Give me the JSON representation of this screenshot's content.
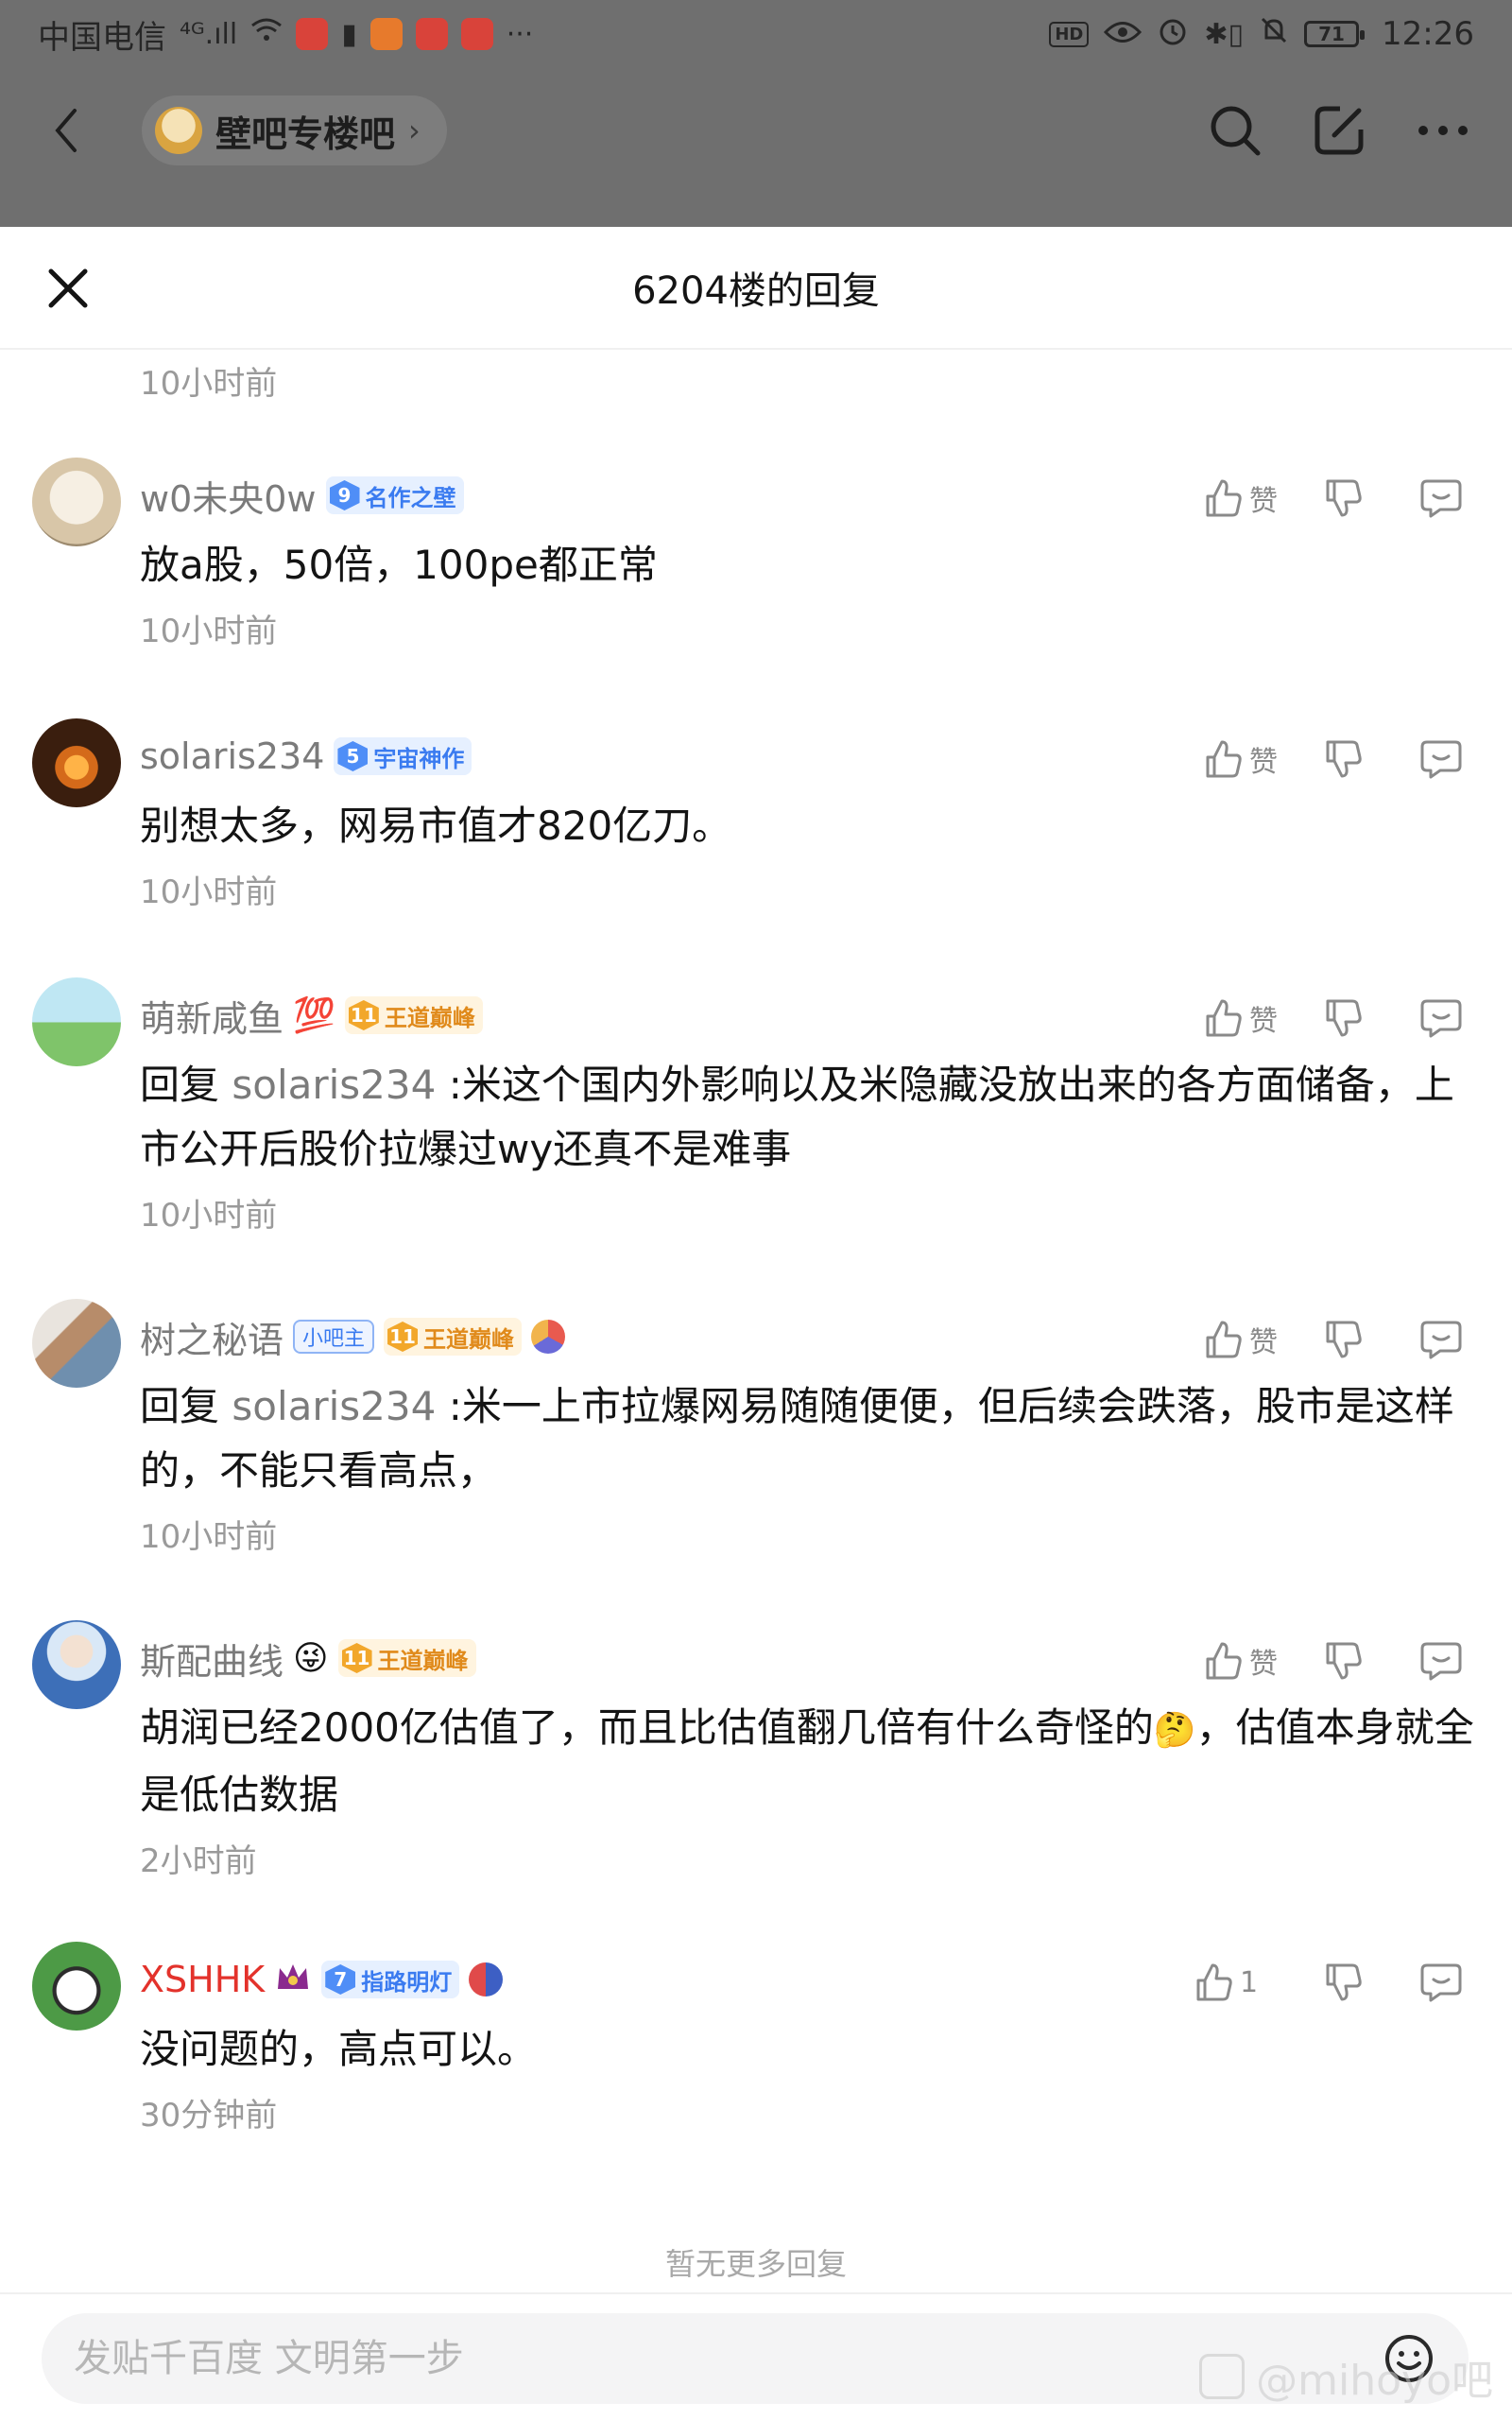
{
  "status_bar": {
    "carrier": "中国电信",
    "signal": "⁴ᴳ.ıll",
    "hd": "HD",
    "battery": "71",
    "time": "12:26"
  },
  "nav": {
    "forum_name": "壁吧专楼吧",
    "chevron": "›"
  },
  "sheet": {
    "title": "6204楼的回复",
    "top_time": "10小时前"
  },
  "comments": [
    {
      "name": "w0未央0w",
      "badge_level": "9",
      "badge_text": "名作之壁",
      "text": "放a股，50倍，100pe都正常",
      "time": "10小时前",
      "like": "赞"
    },
    {
      "name": "solaris234",
      "badge_level": "5",
      "badge_text": "宇宙神作",
      "text": "别想太多，网易市值才820亿刀。",
      "time": "10小时前",
      "like": "赞"
    },
    {
      "name": "萌新咸鱼",
      "name_emoji": "💯",
      "badge_level": "11",
      "badge_text": "王道巅峰",
      "reply_prefix": "回复",
      "reply_to": "solaris234",
      "text": " :米这个国内外影响以及米隐藏没放出来的各方面储备，上市公开后股价拉爆过wy还真不是难事",
      "time": "10小时前",
      "like": "赞"
    },
    {
      "name": "树之秘语",
      "mod_badge": "小吧主",
      "badge_level": "11",
      "badge_text": "王道巅峰",
      "reply_prefix": "回复",
      "reply_to": "solaris234",
      "text": " :米一上市拉爆网易随随便便，但后续会跌落，股市是这样的，不能只看高点，",
      "time": "10小时前",
      "like": "赞"
    },
    {
      "name": "斯配曲线",
      "name_emoji": "😜",
      "badge_level": "11",
      "badge_text": "王道巅峰",
      "text_a": "胡润已经2000亿估值了，而且比估值翻几倍有什么奇怪的",
      "inline_emoji": "🤔",
      "text_b": "，估值本身就全是低估数据",
      "time": "2小时前",
      "like": "赞"
    },
    {
      "name": "XSHHK",
      "badge_level": "7",
      "badge_text": "指路明灯",
      "text": "没问题的，高点可以。",
      "time": "30分钟前",
      "like": "1"
    }
  ],
  "footer": {
    "no_more": "暂无更多回复",
    "input_placeholder": "发贴千百度 文明第一步",
    "watermark": "@mihoyo吧"
  },
  "colors": {
    "dim_overlay": "#6f6f6f",
    "vip_name_red": "#e3322b",
    "badge_blue": "#4f8ef7",
    "badge_gold": "#f2a72b"
  }
}
